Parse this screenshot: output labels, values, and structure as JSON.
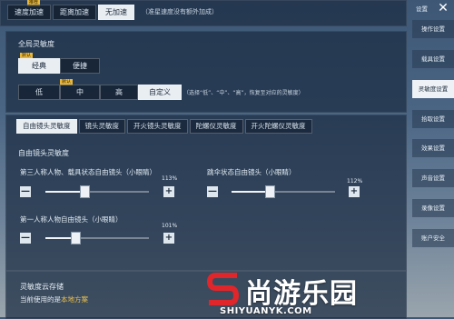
{
  "top_bar": {
    "tag": "推荐",
    "options": [
      "速度加速",
      "距离加速",
      "无加速"
    ],
    "active_index": 2,
    "note": "（准星速度没有额外加成）"
  },
  "global_sensitivity": {
    "title": "全局灵敏度",
    "mode_tag": "默认",
    "modes": [
      "经典",
      "便捷"
    ],
    "active_mode": 0,
    "level_tag": "默认",
    "levels": [
      "低",
      "中",
      "高",
      "自定义"
    ],
    "active_level": 3,
    "level_note": "（选择“低”、“中”、“高”，恢复至对应的灵敏度）"
  },
  "tabs": [
    "自由镜头灵敏度",
    "镜头灵敏度",
    "开火镜头灵敏度",
    "陀螺仪灵敏度",
    "开火陀螺仪灵敏度"
  ],
  "active_tab": 0,
  "section": {
    "title": "自由镜头灵敏度",
    "sliders": [
      {
        "label": "第三人称人物、载具状态自由镜头（小眼睛）",
        "value_text": "113%",
        "value": 113
      },
      {
        "label": "跳伞状态自由镜头（小眼睛）",
        "value_text": "112%",
        "value": 112
      },
      {
        "label": "第一人称人物自由镜头（小眼睛）",
        "value_text": "101%",
        "value": 101
      }
    ],
    "minus": "—",
    "plus": "+"
  },
  "cloud": {
    "title": "灵敏度云存储",
    "current_prefix": "当前使用的是",
    "current_value": "本地方案"
  },
  "sidebar": {
    "title": "设置",
    "close": "✕",
    "items": [
      "操作设置",
      "载具设置",
      "灵敏度设置",
      "拾取设置",
      "效果设置",
      "声音设置",
      "录像设置",
      "账户安全"
    ],
    "active_index": 2
  },
  "watermark": {
    "text": "尚游乐园",
    "url": "SHIYUANYK.COM",
    "color": "#e0262b"
  }
}
